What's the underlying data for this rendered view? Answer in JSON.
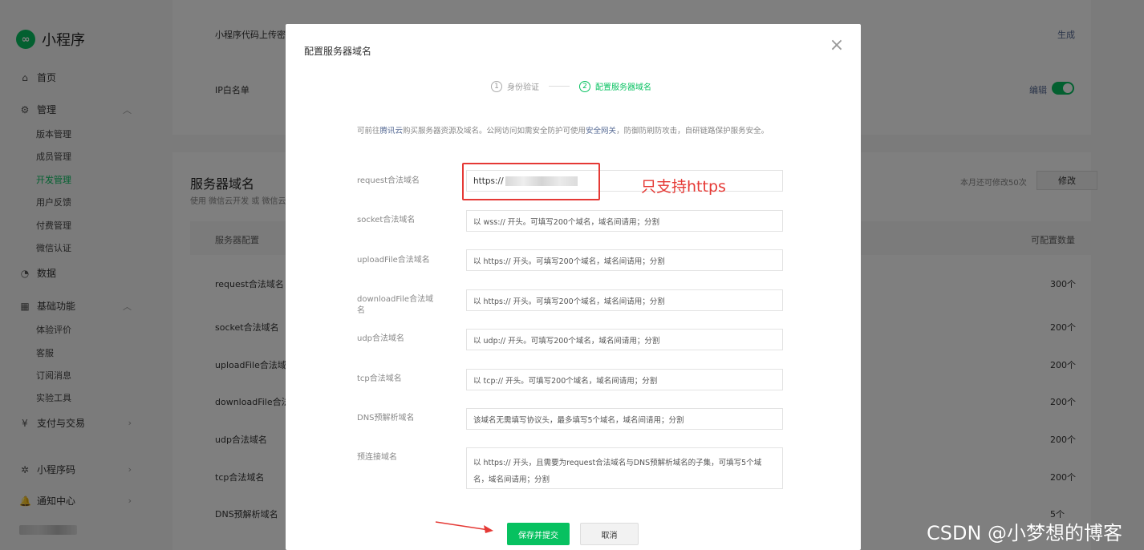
{
  "app": {
    "name": "小程序"
  },
  "sidebar": {
    "home": "首页",
    "manage": "管理",
    "manage_items": [
      "版本管理",
      "成员管理",
      "开发管理",
      "用户反馈",
      "付费管理",
      "微信认证"
    ],
    "data": "数据",
    "basic": "基础功能",
    "basic_items": [
      "体验评价",
      "客服",
      "订阅消息",
      "实验工具"
    ],
    "pay": "支付与交易",
    "qrcode": "小程序码",
    "notify": "通知中心"
  },
  "background": {
    "upload_key_label": "小程序代码上传密钥",
    "generate_link": "生成",
    "ip_whitelist_label": "IP白名单",
    "edit_link": "编辑",
    "server_domain_title": "服务器域名",
    "server_domain_sub": "使用 微信云开发 或 微信云",
    "modify_quota": "本月还可修改50次",
    "modify_button": "修改",
    "table_head_left": "服务器配置",
    "table_head_right": "可配置数量",
    "rows": [
      {
        "name": "request合法域名",
        "count": "300个"
      },
      {
        "name": "socket合法域名",
        "count": "200个"
      },
      {
        "name": "uploadFile合法域",
        "count": "200个"
      },
      {
        "name": "downloadFile合法",
        "count": "200个"
      },
      {
        "name": "udp合法域名",
        "count": "200个"
      },
      {
        "name": "tcp合法域名",
        "count": "200个"
      },
      {
        "name": "DNS预解析域名",
        "count": "5个"
      }
    ]
  },
  "modal": {
    "title": "配置服务器域名",
    "steps": [
      {
        "num": "1",
        "label": "身份验证"
      },
      {
        "num": "2",
        "label": "配置服务器域名"
      }
    ],
    "intro": {
      "p1": "可前往",
      "link1": "腾讯云",
      "p2": "购买服务器资源及域名。公网访问如需安全防护可使用",
      "link2": "安全网关",
      "p3": "，防御防刷防攻击，自研链路保护服务安全。"
    },
    "fields": [
      {
        "label": "request合法域名",
        "value": "https://"
      },
      {
        "label": "socket合法域名",
        "placeholder": "以 wss:// 开头。可填写200个域名，域名间请用；分割"
      },
      {
        "label": "uploadFile合法域名",
        "placeholder": "以 https:// 开头。可填写200个域名，域名间请用；分割"
      },
      {
        "label": "downloadFile合法域名",
        "placeholder": "以 https:// 开头。可填写200个域名，域名间请用；分割"
      },
      {
        "label": "udp合法域名",
        "placeholder": "以 udp:// 开头。可填写200个域名，域名间请用；分割"
      },
      {
        "label": "tcp合法域名",
        "placeholder": "以 tcp:// 开头。可填写200个域名，域名间请用；分割"
      },
      {
        "label": "DNS预解析域名",
        "placeholder": "该域名无需填写协议头，最多填写5个域名，域名间请用；分割"
      },
      {
        "label": "预连接域名",
        "placeholder": "以 https:// 开头，且需要为request合法域名与DNS预解析域名的子集，可填写5个域名，域名间请用；分割"
      }
    ],
    "annotation": "只支持https",
    "save_label": "保存并提交",
    "cancel_label": "取消"
  },
  "watermark": "CSDN @小梦想的博客",
  "colors": {
    "brand": "#07c160",
    "annotation": "#e53935",
    "link": "#576b95"
  }
}
